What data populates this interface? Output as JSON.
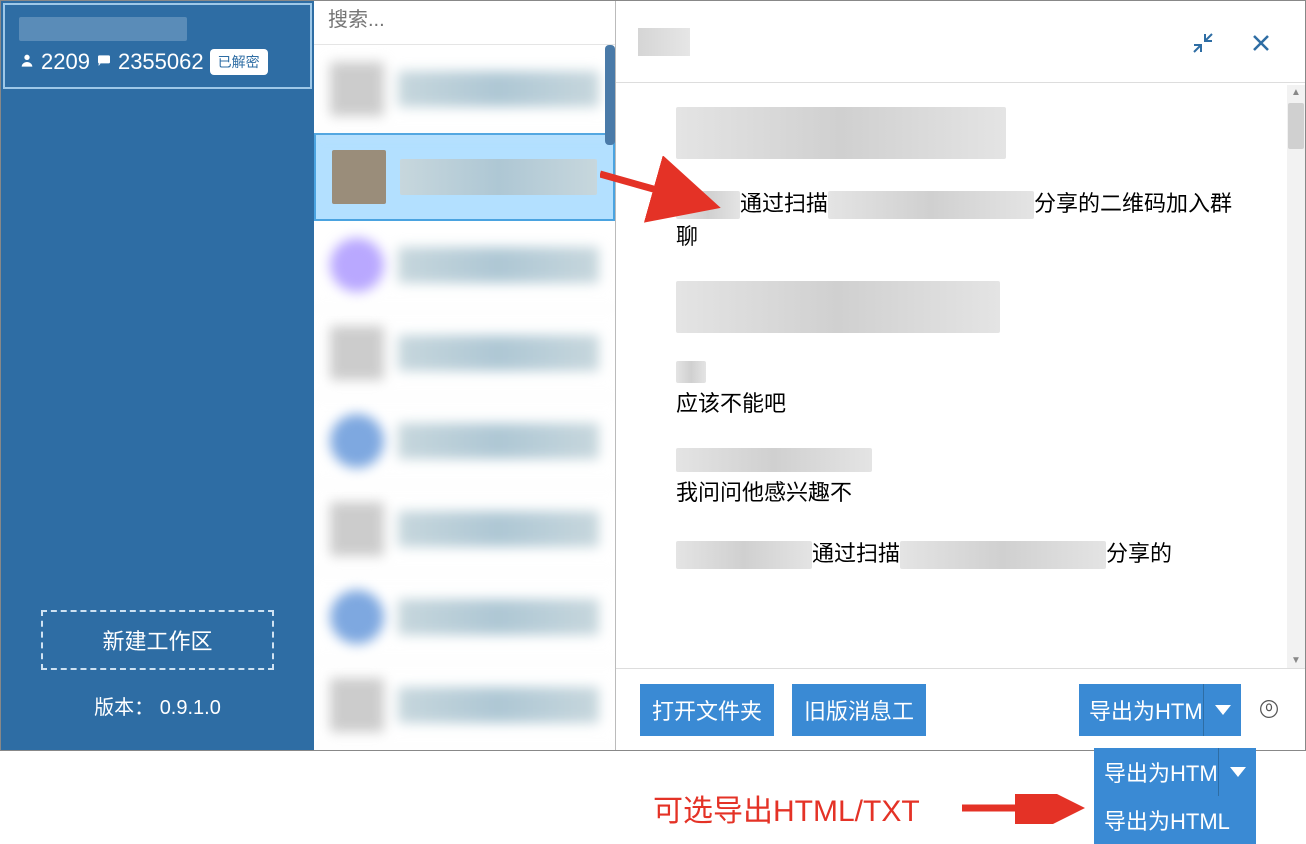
{
  "sidebar": {
    "people_icon": "👤",
    "msg_icon": "💬",
    "people_count": "2209",
    "msg_count": "2355062",
    "pill": "已解密",
    "new_workspace": "新建工作区",
    "version_label": "版本：",
    "version_value": "0.9.1.0"
  },
  "convo": {
    "search_placeholder": "搜索...",
    "items": [
      "",
      "",
      "",
      "",
      "",
      "",
      "",
      ""
    ]
  },
  "chat": {
    "title": "",
    "minimize_icon": "minimize",
    "close_icon": "close",
    "messages": {
      "m1_pre": "",
      "m1_mid": "通过扫描",
      "m1_post": "分享的二维码加入群聊",
      "m2": "应该不能吧",
      "m3": "我问问他感兴趣不",
      "m4_mid": "通过扫描",
      "m4_post": "分享的"
    },
    "footer": {
      "open_folder": "打开文件夹",
      "old_msgs": "旧版消息工",
      "export_html": "导出为HTML",
      "export_html_short": "导出为HTM"
    }
  },
  "annotation": {
    "text": "可选导出HTML/TXT"
  }
}
